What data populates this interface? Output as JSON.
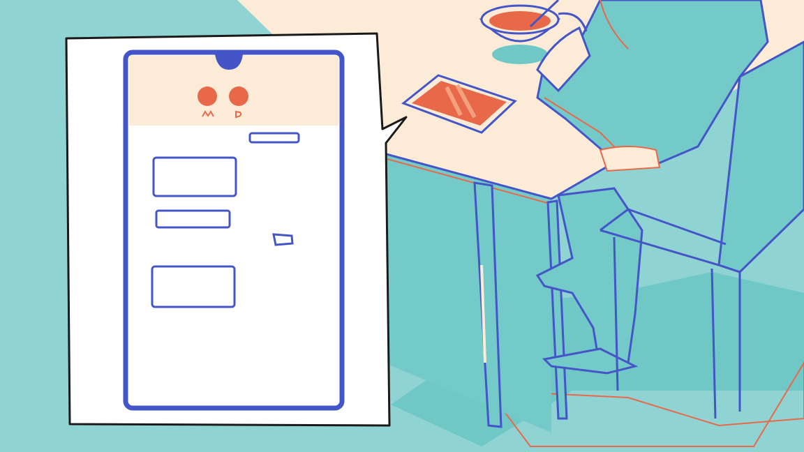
{
  "illustration": {
    "colors": {
      "background": "#8fd3d2",
      "teal_shadow": "#6fc8c6",
      "table_top": "#fcebd6",
      "ink_blue": "#4455c8",
      "accent_orange": "#e8684a",
      "bubble_white": "#ffffff",
      "outline_black": "#1a1a1a"
    },
    "phone": {
      "avatars": [
        "avatar-left",
        "avatar-right"
      ],
      "messages": [
        {
          "side": "right"
        },
        {
          "side": "left"
        },
        {
          "side": "left"
        },
        {
          "side": "right"
        },
        {
          "side": "left"
        }
      ]
    }
  }
}
